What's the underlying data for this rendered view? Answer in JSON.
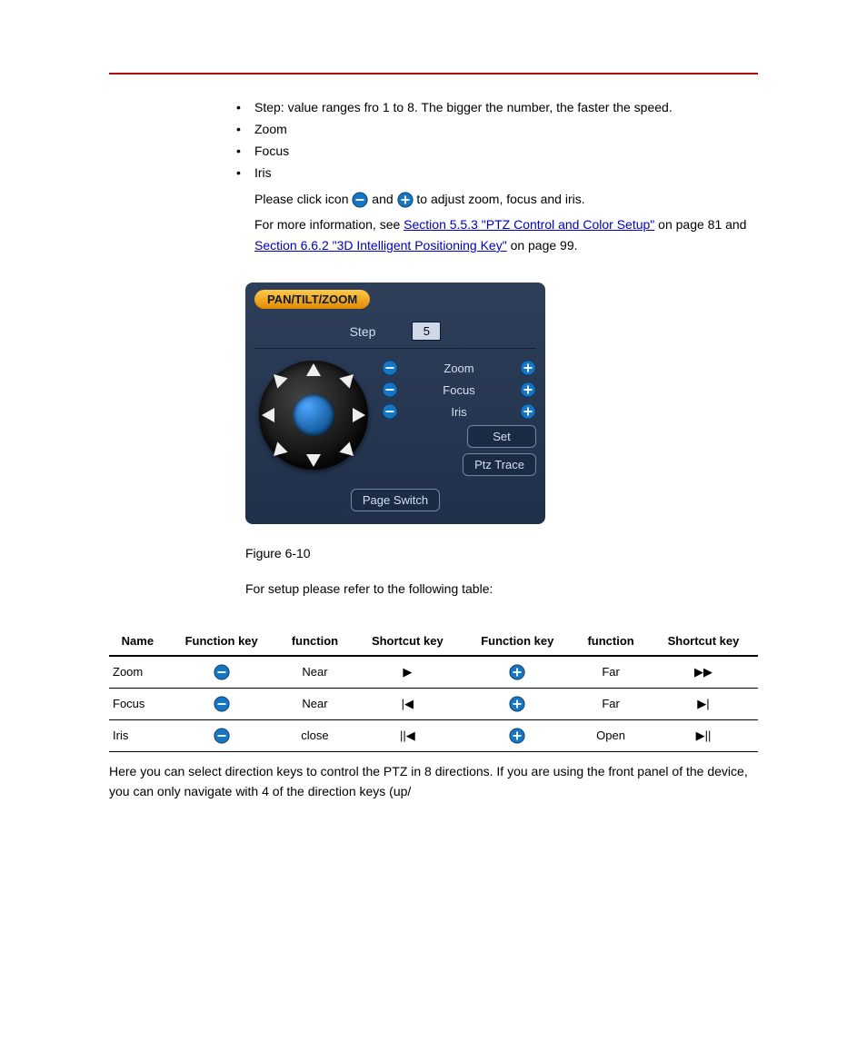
{
  "bullets": [
    "Step: value ranges fro 1 to 8. The bigger the number, the faster the speed.",
    "Zoom",
    "Focus",
    "Iris"
  ],
  "note_prefix": "Please click icon ",
  "note_mid": " and ",
  "note_tail": " to adjust zoom, focus and iris.",
  "note2_part1": "For more information, see ",
  "note2_link1": "Section 5.5.3 \"PTZ Control and Color Setup\"",
  "note2_part2": " on page 81 and ",
  "note2_link2": "Section 6.6.2 \"3D Intelligent Positioning Key\"",
  "note2_part3": " on page 99.",
  "ptz": {
    "title": "PAN/TILT/ZOOM",
    "step_label": "Step",
    "step_value": "5",
    "rows": [
      {
        "label": "Zoom"
      },
      {
        "label": "Focus"
      },
      {
        "label": "Iris"
      }
    ],
    "set_btn": "Set",
    "ptz_trace_btn": "Ptz Trace",
    "page_switch_btn": "Page Switch"
  },
  "figure_caption": "Figure 6-10",
  "para1": "For setup please refer to the following table:",
  "para2": "Here you can select direction keys to control the PTZ in 8 directions. If you are using the front panel of the device, you can only navigate with 4 of the direction keys (up/",
  "table": {
    "headers": [
      "Name",
      "Function key",
      "function",
      "Shortcut key",
      "Function key",
      "function",
      "Shortcut key"
    ],
    "rows": [
      {
        "name": "Zoom",
        "fn1": "Near",
        "s1": "▶",
        "fn2": "Far",
        "s2": "▶▶"
      },
      {
        "name": "Focus",
        "fn1": "Near",
        "s1": "|◀",
        "fn2": "Far",
        "s2": "▶|"
      },
      {
        "name": "Iris",
        "fn1": "close",
        "s1": "||◀",
        "fn2": "Open",
        "s2": "▶||"
      }
    ]
  }
}
